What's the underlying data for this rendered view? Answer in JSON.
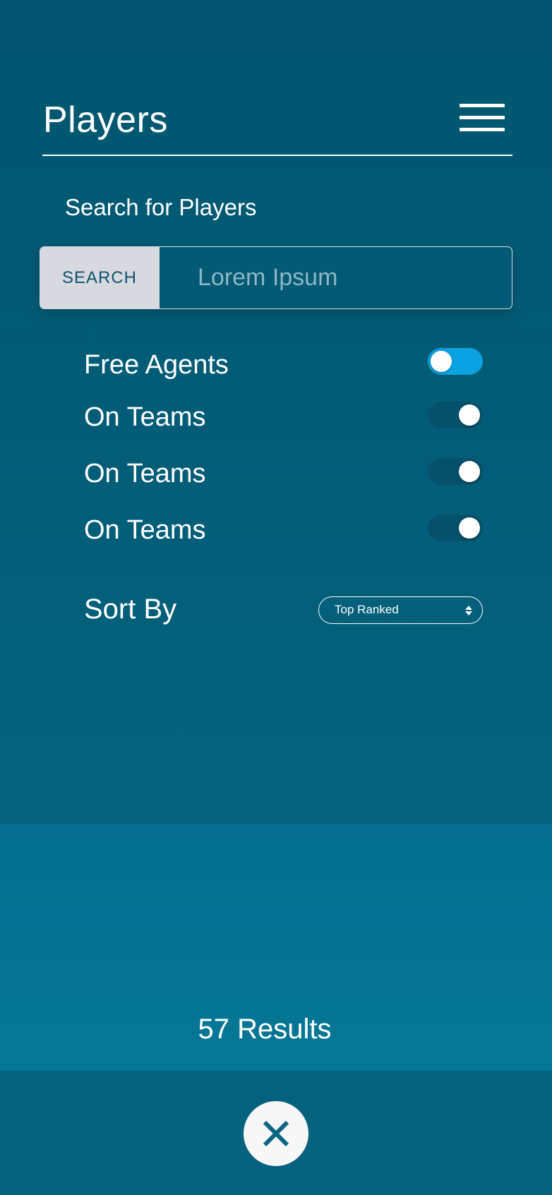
{
  "header": {
    "title": "Players",
    "menu_icon": "hamburger-menu-icon"
  },
  "search": {
    "label": "Search for Players",
    "button_label": "SEARCH",
    "placeholder": "Lorem Ipsum"
  },
  "filters": [
    {
      "label": "Free Agents",
      "toggle_state": "on"
    },
    {
      "label": "On Teams",
      "toggle_state": "off"
    },
    {
      "label": "On Teams",
      "toggle_state": "off"
    },
    {
      "label": "On Teams",
      "toggle_state": "off"
    }
  ],
  "sort": {
    "label": "Sort By",
    "selected": "Top Ranked"
  },
  "results": {
    "count_text": "57 Results"
  },
  "footer": {
    "close_icon": "close-icon"
  },
  "colors": {
    "background": "#03607b",
    "accent_toggle_on": "#0ba2e2",
    "toggle_off": "#05506a",
    "search_button_bg": "#d8d9de",
    "search_button_text": "#0b5570"
  }
}
